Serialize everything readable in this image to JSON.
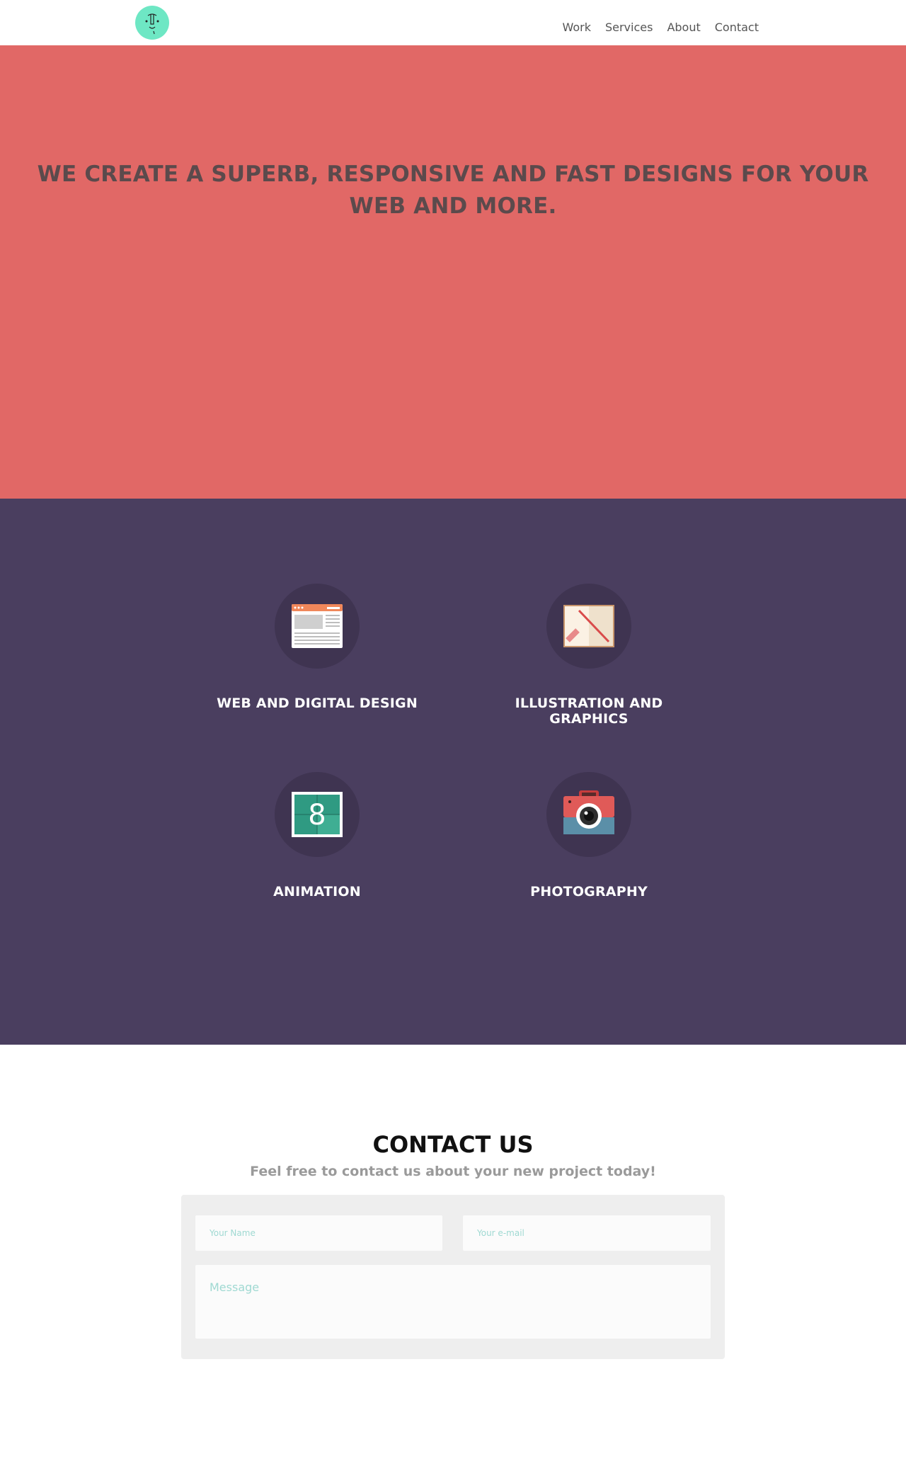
{
  "nav": {
    "items": [
      {
        "label": "Work"
      },
      {
        "label": "Services"
      },
      {
        "label": "About"
      },
      {
        "label": "Contact"
      }
    ]
  },
  "hero": {
    "title": "WE CREATE A SUPERB, RESPONSIVE AND FAST DESIGNS FOR YOUR WEB AND MORE."
  },
  "services": [
    {
      "label": "WEB AND DIGITAL DESIGN",
      "icon": "browser-window-icon"
    },
    {
      "label": "ILLUSTRATION AND GRAPHICS",
      "icon": "pencil-drawing-icon"
    },
    {
      "label": "ANIMATION",
      "icon": "film-frame-icon",
      "frame_number": "8"
    },
    {
      "label": "PHOTOGRAPHY",
      "icon": "camera-icon"
    }
  ],
  "contact": {
    "title": "CONTACT US",
    "subtitle": "Feel free to contact us about your new project today!",
    "name_placeholder": "Your Name",
    "email_placeholder": "Your e-mail",
    "message_placeholder": "Message"
  },
  "colors": {
    "hero_bg": "#e16866",
    "services_bg": "#4a3e5f",
    "logo_bg": "#6ee7c4"
  }
}
